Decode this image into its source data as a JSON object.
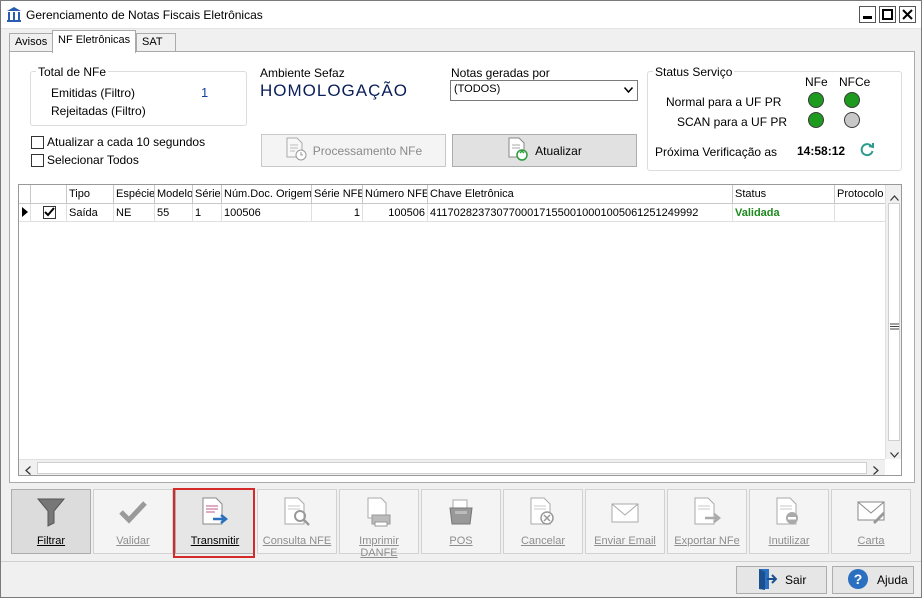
{
  "window": {
    "title": "Gerenciamento de Notas Fiscais Eletrônicas"
  },
  "tabs": [
    {
      "label": "Avisos"
    },
    {
      "label": "NF Eletrônicas"
    },
    {
      "label": "SAT"
    }
  ],
  "totals": {
    "group_label": "Total de NFe",
    "emitidas_label": "Emitidas (Filtro)",
    "emitidas_value": "1",
    "rejeitadas_label": "Rejeitadas (Filtro)"
  },
  "ambiente": {
    "label": "Ambiente Sefaz",
    "value": "HOMOLOGAÇÃO"
  },
  "notas_geradas": {
    "label": "Notas geradas por",
    "selected": "(TODOS)"
  },
  "options": {
    "auto_update_label": "Atualizar a cada 10 segundos",
    "auto_update_checked": false,
    "select_all_label": "Selecionar Todos",
    "select_all_checked": false
  },
  "buttons": {
    "processamento": "Processamento NFe",
    "atualizar": "Atualizar"
  },
  "status_servico": {
    "group_label": "Status Serviço",
    "col_nfe": "NFe",
    "col_nfce": "NFCe",
    "rows": [
      {
        "label": "Normal para a UF PR",
        "nfe": "online",
        "nfce": "online"
      },
      {
        "label": "SCAN para a UF PR",
        "nfe": "online",
        "nfce": "inactive"
      }
    ],
    "next_check_label": "Próxima Verificação as",
    "next_check_time": "14:58:12"
  },
  "colors": {
    "online": "#1e9a1e",
    "inactive": "#c8c8c8",
    "validada": "#1c8a1c",
    "highlight": "#d42a2a"
  },
  "table": {
    "columns": [
      "Tipo",
      "Espécie",
      "Modelo",
      "Série",
      "Núm.Doc. Origem",
      "Série NFE",
      "Número NFE",
      "Chave Eletrônica",
      "Status",
      "Protocolo A"
    ],
    "rows": [
      {
        "checked": true,
        "cells": [
          "Saída",
          "NE",
          "55",
          "1",
          "100506",
          "1",
          "100506",
          "41170282373077000171550010001005061251249992",
          "Validada",
          ""
        ]
      }
    ]
  },
  "toolbar": [
    {
      "label": "Filtrar",
      "icon": "funnel-icon",
      "enabled": true
    },
    {
      "label": "Validar",
      "icon": "check-icon",
      "enabled": false
    },
    {
      "label": "Transmitir",
      "icon": "transmit-document-icon",
      "enabled": true
    },
    {
      "label": "Consulta NFE",
      "icon": "search-document-icon",
      "enabled": false
    },
    {
      "label": "Imprimir DANFE",
      "icon": "print-document-icon",
      "enabled": false
    },
    {
      "label": "POS",
      "icon": "pos-printer-icon",
      "enabled": false
    },
    {
      "label": "Cancelar",
      "icon": "cancel-document-icon",
      "enabled": false
    },
    {
      "label": "Enviar Email",
      "icon": "email-icon",
      "enabled": false
    },
    {
      "label": "Exportar NFe",
      "icon": "export-document-icon",
      "enabled": false
    },
    {
      "label": "Inutilizar",
      "icon": "disable-document-icon",
      "enabled": false
    },
    {
      "label": "Carta",
      "icon": "letter-icon",
      "enabled": false
    }
  ],
  "footer": {
    "exit_label": "Sair",
    "help_label": "Ajuda"
  }
}
